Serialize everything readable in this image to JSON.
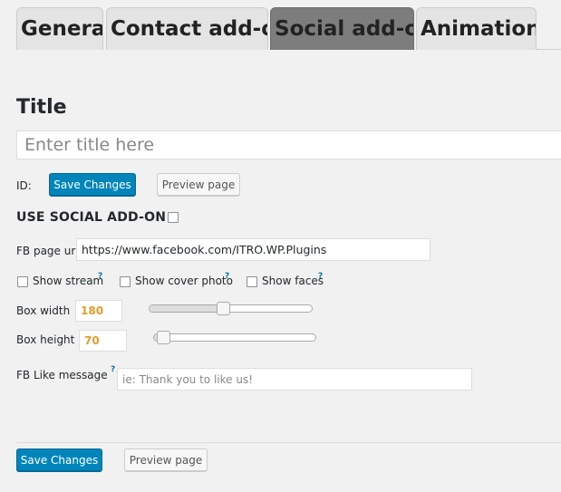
{
  "tabs": [
    {
      "label": "General",
      "active": false
    },
    {
      "label": "Contact add-on",
      "active": false
    },
    {
      "label": "Social add-on",
      "active": true
    },
    {
      "label": "Animations",
      "active": false
    }
  ],
  "title": {
    "heading": "Title",
    "placeholder": "Enter title here"
  },
  "id_row": {
    "label": "ID:",
    "save_label": "Save Changes",
    "preview_label": "Preview page"
  },
  "social": {
    "heading": "USE SOCIAL ADD-ON",
    "enabled": false,
    "fb_url_label": "FB page url:",
    "fb_url_value": "https://www.facebook.com/ITRO.WP.Plugins",
    "show_stream_label": "Show stream",
    "show_cover_label": "Show cover photo",
    "show_faces_label": "Show faces",
    "help_glyph": "?",
    "box_width_label": "Box width",
    "box_width_value": "180",
    "box_width_level": 0.45,
    "box_height_label": "Box height",
    "box_height_value": "70",
    "box_height_level": 0.06,
    "like_msg_label": "FB Like message",
    "like_msg_placeholder": "ie: Thank you to like us!"
  },
  "footer": {
    "save_label": "Save Changes",
    "preview_label": "Preview page"
  },
  "colors": {
    "primary_button": "#0085ba",
    "active_tab": "#7d7d7d",
    "number_text": "#e69b2a",
    "help_icon": "#0073aa"
  }
}
